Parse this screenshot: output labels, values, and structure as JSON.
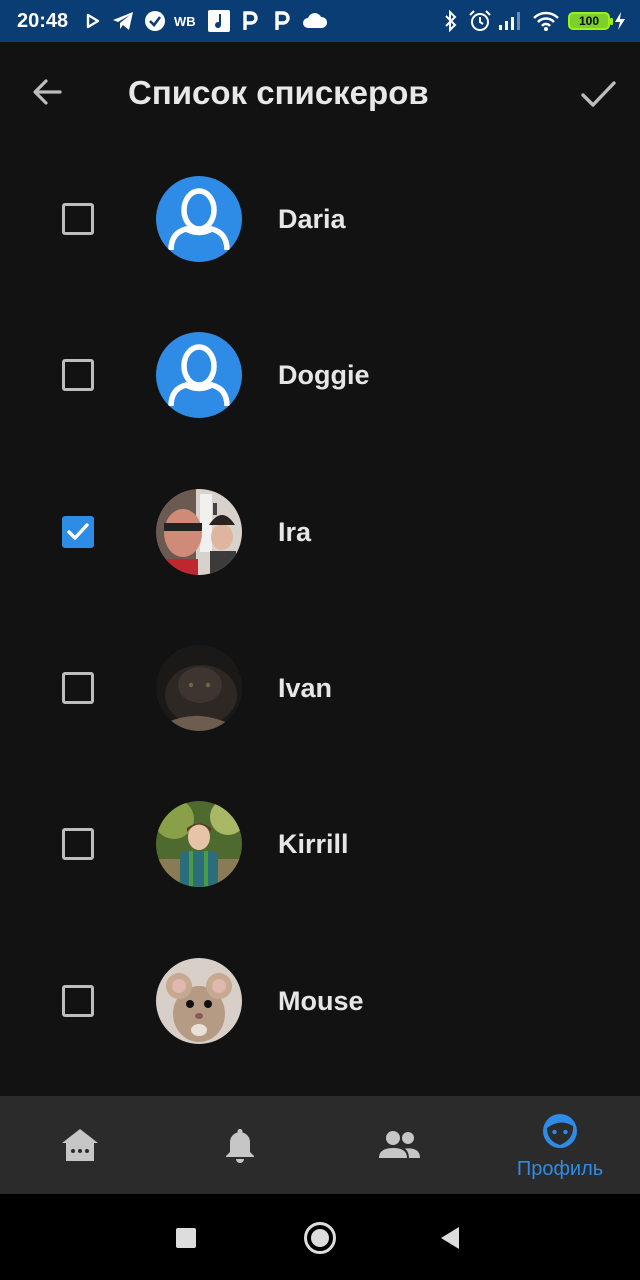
{
  "status_bar": {
    "time": "20:48",
    "wb_label": "WB",
    "battery": "100"
  },
  "app_bar": {
    "title": "Список спискеров",
    "back_icon": "arrow-left-icon",
    "confirm_icon": "check-icon"
  },
  "speakers": [
    {
      "name": "Daria",
      "checked": false,
      "avatar": "default"
    },
    {
      "name": "Doggie",
      "checked": false,
      "avatar": "default"
    },
    {
      "name": "Ira",
      "checked": true,
      "avatar": "photo"
    },
    {
      "name": "Ivan",
      "checked": false,
      "avatar": "photo"
    },
    {
      "name": "Kirrill",
      "checked": false,
      "avatar": "photo"
    },
    {
      "name": "Mouse",
      "checked": false,
      "avatar": "photo"
    }
  ],
  "bottom_nav": {
    "items": [
      {
        "icon": "home-icon"
      },
      {
        "icon": "bell-icon"
      },
      {
        "icon": "people-icon"
      },
      {
        "icon": "profile-face-icon",
        "label": "Профиль",
        "active": true
      }
    ]
  },
  "colors": {
    "accent": "#2f8ce6",
    "background": "#121212",
    "status_bar": "#0a3d73",
    "bottom_nav": "#2b2b2b"
  }
}
